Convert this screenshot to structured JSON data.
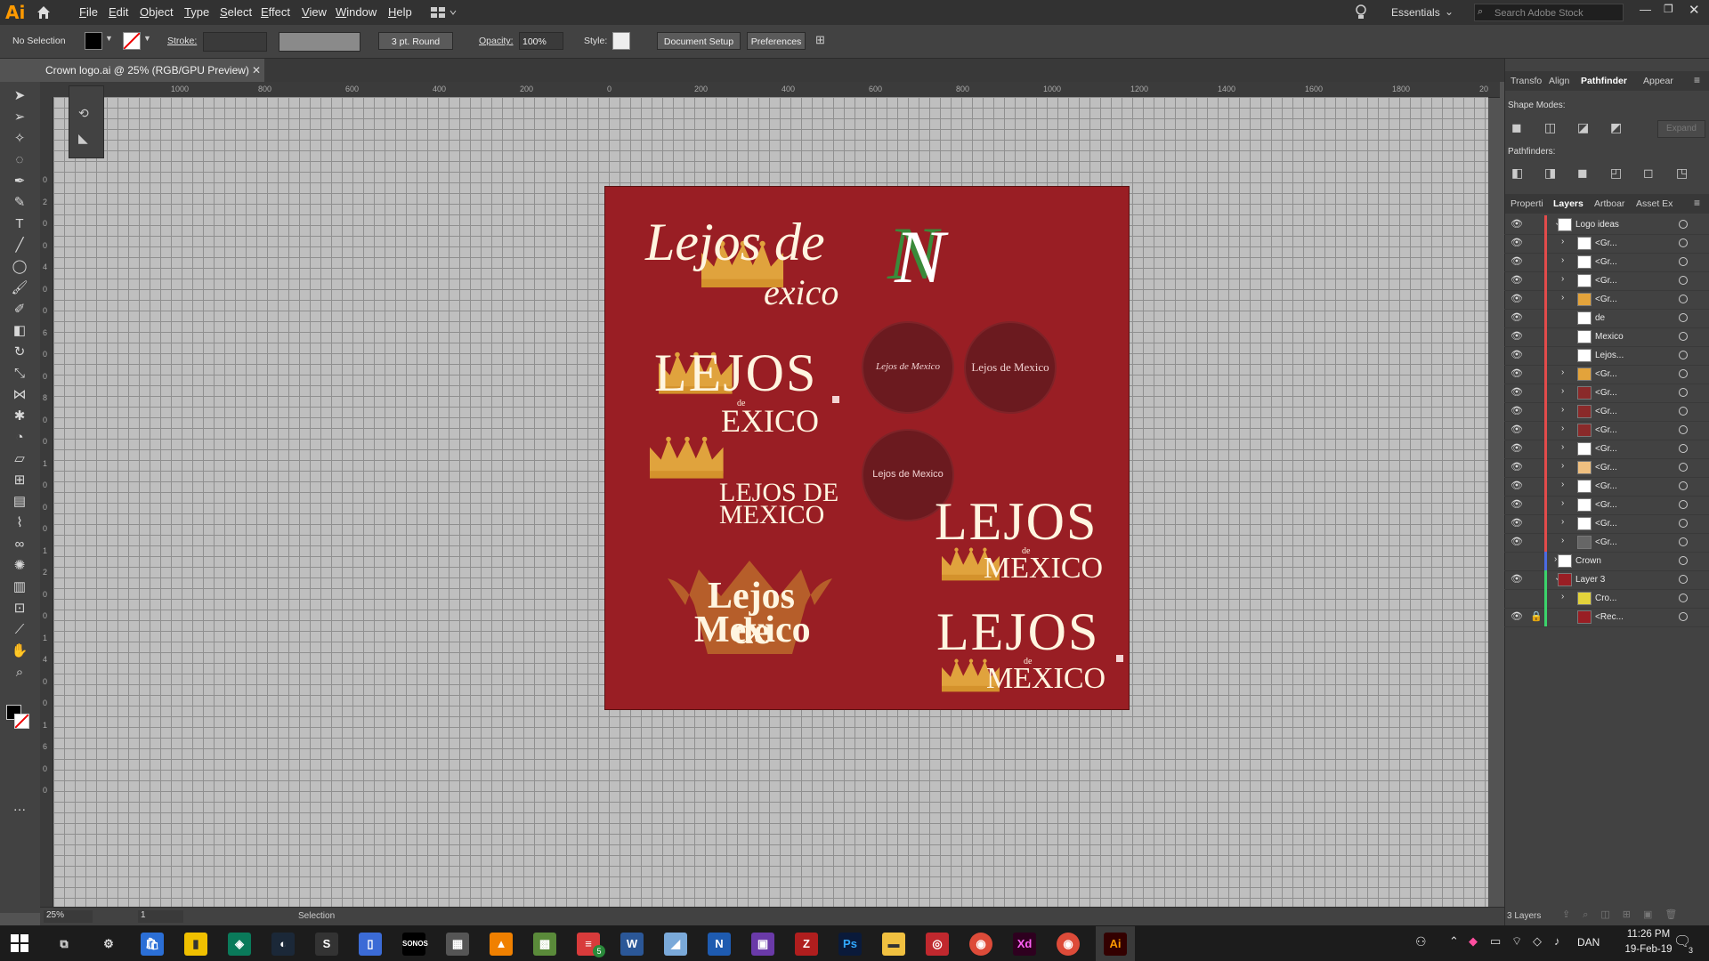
{
  "app": {
    "logo_text": "Ai"
  },
  "menu": [
    "File",
    "Edit",
    "Object",
    "Type",
    "Select",
    "Effect",
    "View",
    "Window",
    "Help"
  ],
  "workspace": {
    "label": "Essentials",
    "search_placeholder": "Search Adobe Stock"
  },
  "control_bar": {
    "selection_label": "No Selection",
    "stroke_label": "Stroke:",
    "brush_label": "3 pt. Round",
    "opacity_label": "Opacity:",
    "opacity_value": "100%",
    "style_label": "Style:",
    "document_setup": "Document Setup",
    "preferences": "Preferences"
  },
  "document_tab": {
    "title": "Crown logo.ai @ 25% (RGB/GPU Preview)"
  },
  "rulers": {
    "top": [
      "1000",
      "800",
      "600",
      "400",
      "200",
      "0",
      "200",
      "400",
      "600",
      "800",
      "1000",
      "1200",
      "1400",
      "1600",
      "1800",
      "20"
    ],
    "left": [
      "0",
      "2",
      "0",
      "0",
      "4",
      "0",
      "0",
      "6",
      "0",
      "0",
      "8",
      "0",
      "0",
      "1",
      "0",
      "0",
      "0",
      "1",
      "2",
      "0",
      "0",
      "1",
      "4",
      "0",
      "0",
      "1",
      "6",
      "0",
      "0"
    ]
  },
  "artboard": {
    "bg_color": "#991e24",
    "logo1": {
      "line1": "Lejos de",
      "line2": "exico"
    },
    "logo2": {
      "big": "LEJOS",
      "small": "de",
      "bottom": "EXICO"
    },
    "logo3": {
      "line1": "LEJOS DE",
      "line2": "MEXICO"
    },
    "logo4": {
      "line1": "Lejos de",
      "line2": "Mexico"
    },
    "logo5_letter": "N",
    "circle1": "Lejos de Mexico",
    "circle2": "Lejos de Mexico",
    "circle3": "Lejos de Mexico",
    "logo6": {
      "big": "LEJOS",
      "small": "de",
      "bottom": "MEXICO"
    },
    "logo7": {
      "big": "LEJOS",
      "small": "de",
      "bottom": "MEXICO"
    }
  },
  "top_panel": {
    "tabs": [
      "Transfo",
      "Align",
      "Pathfinder",
      "Appear"
    ],
    "active": "Pathfinder",
    "shape_modes": "Shape Modes:",
    "pathfinders": "Pathfinders:",
    "expand": "Expand"
  },
  "layers_panel": {
    "tabs": [
      "Properti",
      "Layers",
      "Artboar",
      "Asset Ex"
    ],
    "active": "Layers",
    "rows": [
      {
        "name": "Logo ideas",
        "indent": 0,
        "expander": "v",
        "eye": true,
        "lock": false,
        "bar": "#e34b4b",
        "thumb": "#ffffff"
      },
      {
        "name": "<Gr...",
        "indent": 1,
        "expander": ">",
        "eye": true,
        "lock": false,
        "bar": "#e34b4b",
        "thumb": "#ffffff"
      },
      {
        "name": "<Gr...",
        "indent": 1,
        "expander": ">",
        "eye": true,
        "lock": false,
        "bar": "#e34b4b",
        "thumb": "#ffffff"
      },
      {
        "name": "<Gr...",
        "indent": 1,
        "expander": ">",
        "eye": true,
        "lock": false,
        "bar": "#e34b4b",
        "thumb": "#ffffff"
      },
      {
        "name": "<Gr...",
        "indent": 1,
        "expander": ">",
        "eye": true,
        "lock": false,
        "bar": "#e34b4b",
        "thumb": "#e3a33b"
      },
      {
        "name": "de",
        "indent": 1,
        "expander": "",
        "eye": true,
        "lock": false,
        "bar": "#e34b4b",
        "thumb": "#ffffff"
      },
      {
        "name": "Mexico",
        "indent": 1,
        "expander": "",
        "eye": true,
        "lock": false,
        "bar": "#e34b4b",
        "thumb": "#ffffff"
      },
      {
        "name": "Lejos...",
        "indent": 1,
        "expander": "",
        "eye": true,
        "lock": false,
        "bar": "#e34b4b",
        "thumb": "#ffffff"
      },
      {
        "name": "<Gr...",
        "indent": 1,
        "expander": ">",
        "eye": true,
        "lock": false,
        "bar": "#e34b4b",
        "thumb": "#e3a33b"
      },
      {
        "name": "<Gr...",
        "indent": 1,
        "expander": ">",
        "eye": true,
        "lock": false,
        "bar": "#e34b4b",
        "thumb": "#8a2a2a"
      },
      {
        "name": "<Gr...",
        "indent": 1,
        "expander": ">",
        "eye": true,
        "lock": false,
        "bar": "#e34b4b",
        "thumb": "#8a2a2a"
      },
      {
        "name": "<Gr...",
        "indent": 1,
        "expander": ">",
        "eye": true,
        "lock": false,
        "bar": "#e34b4b",
        "thumb": "#8a2a2a"
      },
      {
        "name": "<Gr...",
        "indent": 1,
        "expander": ">",
        "eye": true,
        "lock": false,
        "bar": "#e34b4b",
        "thumb": "#ffffff"
      },
      {
        "name": "<Gr...",
        "indent": 1,
        "expander": ">",
        "eye": true,
        "lock": false,
        "bar": "#e34b4b",
        "thumb": "#f0c080"
      },
      {
        "name": "<Gr...",
        "indent": 1,
        "expander": ">",
        "eye": true,
        "lock": false,
        "bar": "#e34b4b",
        "thumb": "#ffffff"
      },
      {
        "name": "<Gr...",
        "indent": 1,
        "expander": ">",
        "eye": true,
        "lock": false,
        "bar": "#e34b4b",
        "thumb": "#ffffff"
      },
      {
        "name": "<Gr...",
        "indent": 1,
        "expander": ">",
        "eye": true,
        "lock": false,
        "bar": "#e34b4b",
        "thumb": "#ffffff"
      },
      {
        "name": "<Gr...",
        "indent": 1,
        "expander": ">",
        "eye": true,
        "lock": false,
        "bar": "#e34b4b",
        "thumb": "#666666"
      },
      {
        "name": "Crown",
        "indent": 0,
        "expander": ">",
        "eye": false,
        "lock": false,
        "bar": "#4b6be3",
        "thumb": "#ffffff"
      },
      {
        "name": "Layer 3",
        "indent": 0,
        "expander": "v",
        "eye": true,
        "lock": false,
        "bar": "#3bd36b",
        "thumb": "#991e24"
      },
      {
        "name": "Cro...",
        "indent": 1,
        "expander": ">",
        "eye": false,
        "lock": false,
        "bar": "#3bd36b",
        "thumb": "#e3d33b"
      },
      {
        "name": "<Rec...",
        "indent": 1,
        "expander": "",
        "eye": true,
        "lock": true,
        "bar": "#3bd36b",
        "thumb": "#991e24"
      }
    ],
    "footer": "3 Layers"
  },
  "status_bar": {
    "zoom": "25%",
    "artboard_num": "1",
    "tool": "Selection"
  },
  "taskbar": {
    "language": "DAN",
    "time": "11:26 PM",
    "date": "19-Feb-19",
    "notification_count": "3",
    "badge_count": "5"
  }
}
